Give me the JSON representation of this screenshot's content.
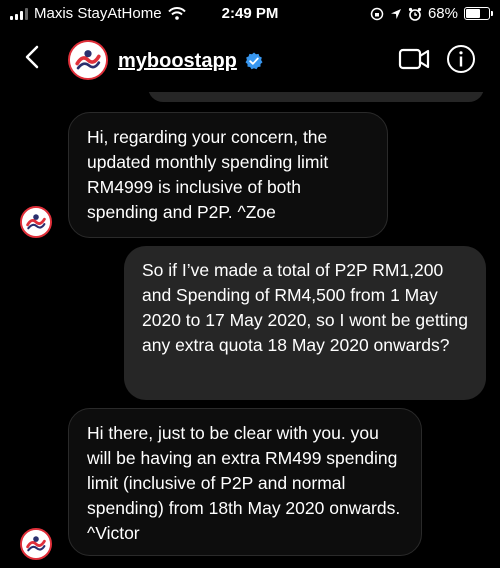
{
  "status_bar": {
    "carrier": "Maxis StayAtHome",
    "time": "2:49 PM",
    "battery": "68%",
    "battery_level": 0.68
  },
  "header": {
    "username": "myboostapp"
  },
  "messages": [
    {
      "direction": "incoming",
      "text": "Hi, regarding your concern, the updated monthly spending limit RM4999 is inclusive of both spending and P2P. ^Zoe"
    },
    {
      "direction": "outgoing",
      "text": "So if I’ve made a total of P2P RM1,200 and Spending of RM4,500 from 1 May 2020 to 17 May 2020, so I wont be getting any extra quota 18 May 2020 onwards?"
    },
    {
      "direction": "incoming",
      "text": "Hi there, just to be clear with you. you will be having an extra RM499 spending limit (inclusive of P2P and normal spending) from 18th May 2020 onwards. ^Victor"
    }
  ],
  "colors": {
    "background": "#000000",
    "incoming_bubble": "#0d0d0d",
    "outgoing_bubble": "#262626",
    "verified_badge": "#3897f0",
    "avatar_ring": "#e0303a"
  },
  "icons": [
    "signal-icon",
    "wifi-icon",
    "lock-rotation-icon",
    "location-icon",
    "alarm-icon",
    "battery-icon",
    "back-chevron-icon",
    "verified-icon",
    "video-call-icon",
    "info-icon"
  ]
}
